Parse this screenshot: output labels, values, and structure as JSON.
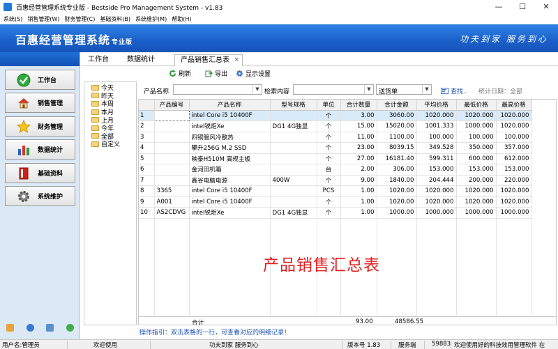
{
  "window": {
    "title": "百惠经营管理系统专业版 - Bestside Pro Management System - v1.83",
    "controls": [
      "—",
      "☐",
      "✕"
    ]
  },
  "menu": [
    "系统(S)",
    "销售管理(W)",
    "财务管理(C)",
    "基础资料(B)",
    "系统维护(M)",
    "帮助(H)"
  ],
  "banner": {
    "title": "百惠经营管理系统",
    "subtitle": "专业版",
    "slogan": "功夫到家  服务到心"
  },
  "nav": [
    {
      "label": "工作台",
      "icon": "check-icon"
    },
    {
      "label": "销售管理",
      "icon": "house-icon"
    },
    {
      "label": "财务管理",
      "icon": "star-icon"
    },
    {
      "label": "数据统计",
      "icon": "bar-chart-icon"
    },
    {
      "label": "基础资料",
      "icon": "book-icon"
    },
    {
      "label": "系统维护",
      "icon": "gear-icon"
    }
  ],
  "tabs": [
    "工作台",
    "数据统计",
    "产品销售汇总表"
  ],
  "toolbar": {
    "refresh": "刷新",
    "export": "导出",
    "display": "显示设置"
  },
  "tree": [
    "今天",
    "昨天",
    "本周",
    "本月",
    "上月",
    "今年",
    "全部",
    "自定义"
  ],
  "filter": {
    "product_label": "产品名称",
    "search_label": "检索内容",
    "doc_type": "送货单",
    "find": "查找..",
    "stat_date": "统计日期：全部"
  },
  "table": {
    "columns": [
      "",
      "产品编号",
      "产品名称",
      "型号规格",
      "单位",
      "合计数量",
      "合计金额",
      "平均价格",
      "最低价格",
      "最高价格"
    ],
    "rows": [
      [
        "1",
        "",
        "intel Core i5 10400F",
        "",
        "个",
        "3.00",
        "3060.00",
        "1020.000",
        "1020.000",
        "1020.000"
      ],
      [
        "2",
        "",
        "intel锐炬Xe",
        "DG1 4G独显",
        "个",
        "15.00",
        "15020.00",
        "1001.333",
        "1000.000",
        "1020.000"
      ],
      [
        "3",
        "",
        "四铜管风冷散热",
        "",
        "个",
        "11.00",
        "1100.00",
        "100.000",
        "100.000",
        "100.000"
      ],
      [
        "4",
        "",
        "攀升256G M.2 SSD",
        "",
        "个",
        "23.00",
        "8039.15",
        "349.528",
        "350.000",
        "357.000"
      ],
      [
        "5",
        "",
        "映泰H510M 高规主板",
        "",
        "个",
        "27.00",
        "16181.40",
        "599.311",
        "600.000",
        "612.000"
      ],
      [
        "6",
        "",
        "金河田机箱",
        "",
        "台",
        "2.00",
        "306.00",
        "153.000",
        "153.000",
        "153.000"
      ],
      [
        "7",
        "",
        "鑫谷电脑电源",
        "400W",
        "个",
        "9.00",
        "1840.00",
        "204.444",
        "200.000",
        "220.000"
      ],
      [
        "8",
        "3365",
        "intel Core i5 10400F",
        "",
        "PCS",
        "1.00",
        "1020.00",
        "1020.000",
        "1020.000",
        "1020.000"
      ],
      [
        "9",
        "A001",
        "intel Core i5 10400F",
        "",
        "个",
        "1.00",
        "1020.00",
        "1020.000",
        "1020.000",
        "1020.000"
      ],
      [
        "10",
        "AS2CDVG",
        "intel锐炬Xe",
        "DG1 4G独显",
        "个",
        "1.00",
        "1000.00",
        "1000.000",
        "1000.000",
        "1000.000"
      ]
    ],
    "total_label": "合计",
    "total_qty": "93.00",
    "total_amount": "48586.55"
  },
  "watermark": "产品销售汇总表",
  "hint": "操作指引：双击表格的一行，可查看对应的明细记录！",
  "status": {
    "user": "用户名:管理员",
    "welcome": "欢迎使用",
    "slogan": "功夫到家 服务到心",
    "version": "版本号 1.83",
    "server": "服务端",
    "port": "59883",
    "thanks": "欢迎使用好的科技效用管理软件 在"
  }
}
